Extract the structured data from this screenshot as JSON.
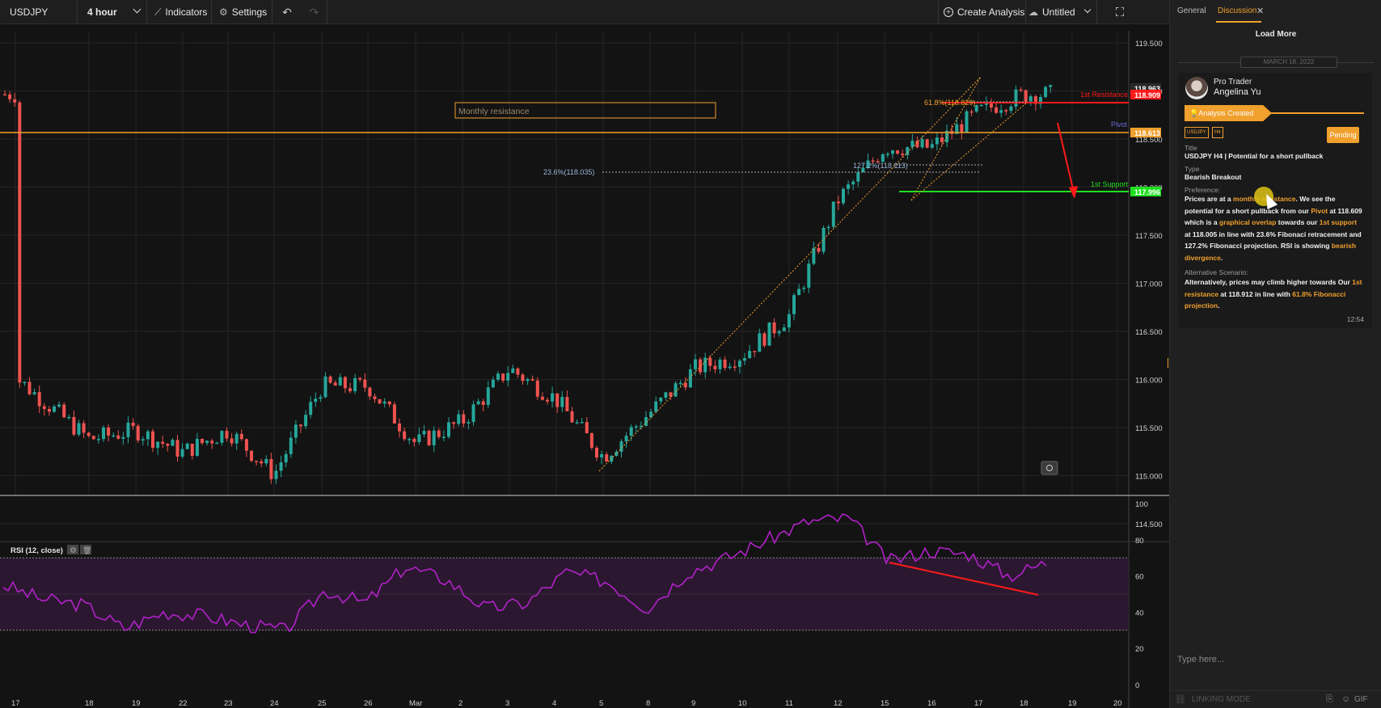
{
  "toolbar": {
    "symbol": "USDJPY",
    "interval": "4 hour",
    "indicators": "Indicators",
    "settings": "Settings",
    "create_analysis": "Create Analysis",
    "layout_name": "Untitled"
  },
  "chart": {
    "monthly_label": "Monthly resistance",
    "fib_618": "61.8%(118.829)",
    "fib_1272": "127.2%(118.113)",
    "fib_236": "23.6%(118.035)",
    "r1_label": "1st Resistance",
    "pivot_label": "Pivot",
    "s1_label": "1st Support",
    "r1_badge": "118.909",
    "r1_badge_top": "118.963",
    "pivot_badge": "118.613",
    "s1_badge": "117.996",
    "rsi_label": "RSI (12, close)",
    "price_ticks": [
      "119.500",
      "118.000",
      "118.500",
      "118.000",
      "117.500",
      "117.000",
      "116.500",
      "116.000",
      "115.500",
      "115.000",
      "114.500"
    ],
    "rsi_ticks": [
      "100",
      "80",
      "60",
      "40",
      "20",
      "0"
    ],
    "time_ticks": [
      "17",
      "18",
      "19",
      "22",
      "23",
      "24",
      "25",
      "26",
      "Mar",
      "2",
      "3",
      "4",
      "5",
      "8",
      "9",
      "10",
      "11",
      "12",
      "15",
      "16",
      "17",
      "18",
      "19",
      "20"
    ],
    "colors": {
      "resistance": "#ff1a1a",
      "pivot": "#f0a02c",
      "support": "#1fe01f",
      "rsi": "#b221c9",
      "bull": "#26a69a",
      "bear": "#ef5350"
    }
  },
  "chart_data": {
    "type": "candlestick",
    "symbol": "USDJPY",
    "interval": "4 hour",
    "close_path": [
      [
        "17",
        115.7
      ],
      [
        "18",
        115.0
      ],
      [
        "19",
        115.1
      ],
      [
        "22",
        114.85
      ],
      [
        "23",
        115.1
      ],
      [
        "24",
        114.6
      ],
      [
        "25",
        115.6
      ],
      [
        "26",
        115.6
      ],
      [
        "Mar",
        114.95
      ],
      [
        "2",
        115.2
      ],
      [
        "3",
        115.8
      ],
      [
        "4",
        115.45
      ],
      [
        "5",
        114.8
      ],
      [
        "8",
        115.3
      ],
      [
        "9",
        115.8
      ],
      [
        "10",
        115.95
      ],
      [
        "11",
        116.4
      ],
      [
        "12",
        117.7
      ],
      [
        "15",
        118.3
      ],
      [
        "16",
        118.3
      ],
      [
        "17",
        118.7
      ],
      [
        "18",
        118.9
      ]
    ],
    "levels": {
      "1st Resistance": 118.909,
      "Pivot": 118.613,
      "1st Support": 117.996
    },
    "y_range": [
      114.4,
      119.6
    ],
    "rsi": {
      "name": "RSI (12, close)",
      "levels": [
        30,
        70
      ],
      "range": [
        0,
        100
      ],
      "values": [
        55,
        47,
        44,
        31,
        40,
        38,
        33,
        30,
        52,
        45,
        65,
        58,
        42,
        45,
        62,
        57,
        42,
        62,
        70,
        80,
        90,
        92,
        68,
        74,
        72,
        60,
        68
      ]
    }
  },
  "panel": {
    "tab_general": "General",
    "tab_discussion": "Discussion",
    "close_x": "✕",
    "load_more": "Load More",
    "date": "MARCH 18, 2022",
    "author_role": "Pro Trader",
    "author_name": "Angelina Yu",
    "analysis_created": "Analysis Created",
    "tag_symbol": "USDJPY",
    "tag_tf": "H4",
    "status": "Pending",
    "title_label": "Title",
    "title_value": "USDJPY H4 | Potential for a short pullback",
    "type_label": "Type",
    "type_value": "Bearish Breakout",
    "pref_label": "Preference:",
    "pref_p1": "Prices are at a ",
    "pref_h1": "monthly resistance",
    "pref_p2": ". We see the potential for a short pullback from our ",
    "pref_h2": "Pivot",
    "pref_p3": " at 118.609 which is a ",
    "pref_h3": "graphical overlap",
    "pref_p4": " towards our ",
    "pref_h4": "1st support",
    "pref_p5": " at 118.005 in line with 23.6% Fibonaci retracement and 127.2% Fibonacci projection. RSI is showing ",
    "pref_h5": "bearish divergence",
    "pref_p6": ".",
    "alt_label": "Alternative Scenario:",
    "alt_p1": "Alternatively, prices may climb higher towards Our ",
    "alt_h1": "1st resistance",
    "alt_p2": " at 118.912 in line with ",
    "alt_h2": "61.8% Fibonacci projection",
    "alt_p3": ".",
    "time": "12:54",
    "input_placeholder": "Type here...",
    "linking_mode": "LINKING MODE",
    "gif": "GIF"
  }
}
